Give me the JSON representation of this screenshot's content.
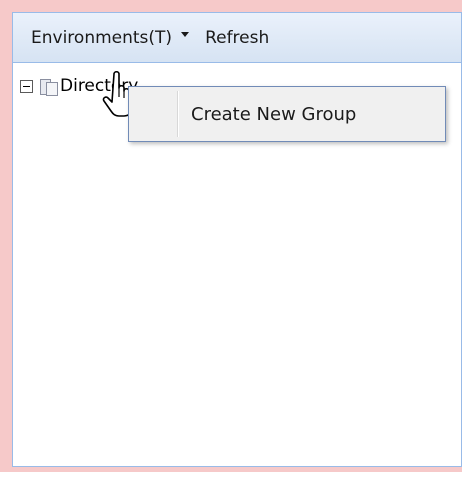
{
  "toolbar": {
    "environments_label": "Environments(T)",
    "refresh_label": "Refresh"
  },
  "tree": {
    "root_label": "Directory"
  },
  "context_menu": {
    "items": [
      {
        "label": "Create New Group"
      }
    ]
  },
  "colors": {
    "panel_border": "#99bbe8",
    "outer_glow": "#f6c9c9",
    "menu_background": "#f0f0f0"
  }
}
